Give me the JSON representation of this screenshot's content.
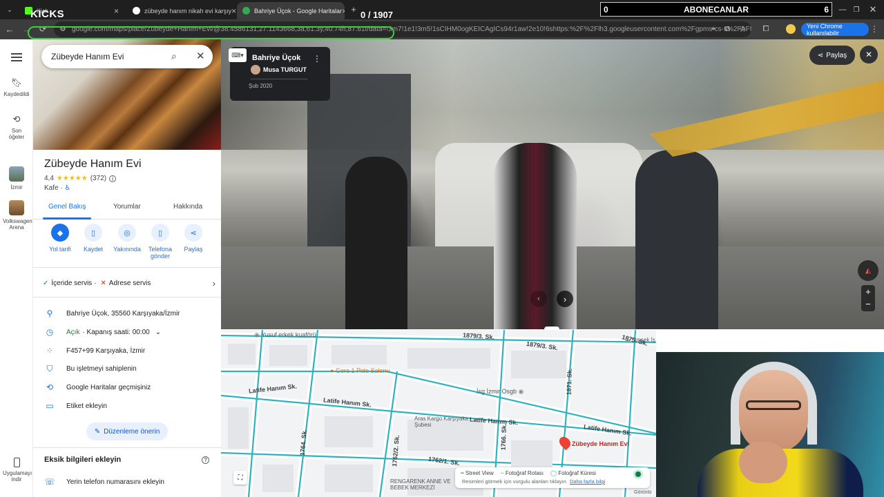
{
  "tabs": [
    {
      "label": "Kick",
      "fav_color": "#53fc18"
    },
    {
      "label": "zübeyde hanım nikah evi karşıy",
      "fav_color": "#ffffff"
    },
    {
      "label": "Bahriye Üçok - Google Haritalar",
      "fav_color": "#34a853"
    }
  ],
  "overlay": {
    "kicks": "KICKS",
    "counter": "0 / 1907",
    "sub_left": "0",
    "sub_title": "ABONECANLAR",
    "sub_right": "6"
  },
  "address": {
    "url": "google.com/maps/place/Zübeyde+Hanım+Evi/@38.4586131,27.1143668,3a,61.3y,40.74h,87.61t/data=!3m7!1e1!3m5!1sCIHM0ogKEICAgICs94r1aw!2e10!6shttps:%2F%2Flh3.googleusercontent.com%2Fgpms-cs-s%2FAFfm...",
    "chrome_chip": "Yeni Chrome kullanılabilir"
  },
  "rail": {
    "saved": "Kaydedildi",
    "recent": "Son öğeler",
    "izmir": "İzmir",
    "volkswagen": "Volkswagen Arena",
    "apps": "Uygulamayı indir"
  },
  "panel": {
    "search_value": "Zübeyde Hanım Evi",
    "title": "Zübeyde Hanım Evi",
    "rating": "4,4",
    "stars": "★★★★★",
    "reviews": "(372)",
    "category": "Kafe ·",
    "tabs": {
      "overview": "Genel Bakış",
      "reviews": "Yorumlar",
      "about": "Hakkında"
    },
    "actions": {
      "directions": "Yol tarifi",
      "save": "Kaydet",
      "nearby": "Yakınında",
      "phone": "Telefona gönder",
      "share": "Paylaş"
    },
    "service": {
      "dine_in": "İçeride servis ·",
      "delivery": "Adrese servis"
    },
    "address": "Bahriye Üçok, 35560 Karşıyaka/İzmir",
    "open": "Açık",
    "closes": "· Kapanış saati: 00:00",
    "pluscode": "F457+99 Karşıyaka, İzmir",
    "claim": "Bu işletmeyi sahiplenin",
    "history": "Google Haritalar geçmişiniz",
    "label": "Etiket ekleyin",
    "suggest_edit": "Düzenleme önerin",
    "missing_title": "Eksik bilgileri ekleyin",
    "add_phone": "Yerin telefon numarasını ekleyin"
  },
  "streetview": {
    "place": "Bahriye Üçok",
    "author": "Musa TURGUT",
    "date": "Şub 2020",
    "share": "Paylaş"
  },
  "map": {
    "streets": [
      "1879/3. Sk.",
      "1879/3. Sk.",
      "Latife Hanım Sk.",
      "Latife Hanım Sk.",
      "Latife Hanım Sk.",
      "Latife Hanım Sk.",
      "1764. Sk.",
      "1762/2. Sk.",
      "1766. Sk.",
      "1762/1. Sk.",
      "1875. Sk.",
      "1871. Sk."
    ],
    "places": {
      "barber": "Yusuf erkek kuaförü",
      "pide": "Gora 1 Pide Salonu",
      "osgb": "İsg İzmir Osgb",
      "aras": "Aras Kargo Karşıyaka Şubesi",
      "pin": "Zübeyde Hanım Evi",
      "hospital": "RENGARENK ANNE VE BEBEK MERKEZİ",
      "simsek": "Şimşek İş Merkez"
    },
    "legend": {
      "sv": "Street View",
      "route": "Fotoğraf Rotası",
      "sphere": "Fotoğraf Küresi",
      "note": "Resimleri görmek için vurgulu alanları tıklayın",
      "link": "Daha fazla bilgi"
    },
    "corner": "Görüntü"
  }
}
